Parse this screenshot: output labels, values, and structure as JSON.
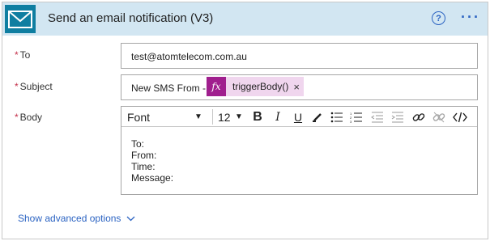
{
  "header": {
    "title": "Send an email notification (V3)",
    "help_icon": "help-circle-icon",
    "help_label": "?",
    "more_icon": "more-options-icon",
    "more_label": "···",
    "accent_color": "#0f7ea1",
    "header_bg": "#d2e6f2"
  },
  "fields": {
    "to": {
      "required_mark": "*",
      "label": "To",
      "value": "test@atomtelecom.com.au"
    },
    "subject": {
      "required_mark": "*",
      "label": "Subject",
      "value_prefix": "New SMS From -",
      "token": {
        "icon": "fx",
        "label": "triggerBody()",
        "close": "×",
        "color": "#a01f8e"
      }
    },
    "body": {
      "required_mark": "*",
      "label": "Body",
      "toolbar": {
        "font": "Font",
        "font_size": "12",
        "bold": "B",
        "italic": "I",
        "underline": "U"
      },
      "content": "To:\nFrom:\nTime:\nMessage:"
    }
  },
  "footer": {
    "advanced_label": "Show advanced options"
  }
}
